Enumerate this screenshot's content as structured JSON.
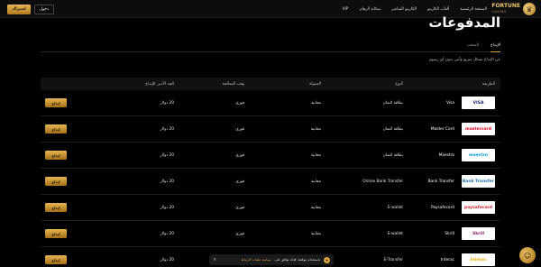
{
  "header": {
    "logo_name": "FORTUNE",
    "logo_sub": "CASINO",
    "nav": [
      "الصفحة الرئيسية",
      "ألعاب الكازينو",
      "الكازينو المباشر",
      "سكانة الرهان",
      "VIP"
    ],
    "login_label": "دخول",
    "register_label": "اشتراك"
  },
  "page": {
    "title": "المدفوعات",
    "tabs": [
      "الإيداع",
      "السحب"
    ],
    "intro": "عن الإيداع بشكل سريع وآمن بدون أي رسوم"
  },
  "table": {
    "headers": {
      "method": "الطريقة",
      "type": "النوع",
      "fee": "العمولة",
      "time": "وقت المعالجة",
      "min": "الحد الأدنى للإيداع",
      "action": ""
    },
    "rows": [
      {
        "name": "Visa",
        "logo": "VISA",
        "logo_color": "#1a1f71",
        "type": "بطاقة ائتمان",
        "fee": "مجانية",
        "time": "فوري",
        "min": "20 دولار",
        "action": "إيداع"
      },
      {
        "name": "Master Card",
        "logo": "mastercard",
        "logo_color": "#eb001b",
        "type": "بطاقة ائتمان",
        "fee": "مجانية",
        "time": "فوري",
        "min": "20 دولار",
        "action": "إيداع"
      },
      {
        "name": "Maestro",
        "logo": "maestro",
        "logo_color": "#0099df",
        "type": "بطاقة ائتمان",
        "fee": "مجانية",
        "time": "فوري",
        "min": "20 دولار",
        "action": "إيداع"
      },
      {
        "name": "Bank Transfer",
        "logo": "Bank Transfer",
        "logo_color": "#1d6fb8",
        "type": "Online Bank Transfer",
        "fee": "مجانية",
        "time": "فوري",
        "min": "20 دولار",
        "action": "إيداع"
      },
      {
        "name": "Paysafecard",
        "logo": "paysafecard",
        "logo_color": "#d2232a",
        "type": "E-wallet",
        "fee": "مجانية",
        "time": "فوري",
        "min": "20 دولار",
        "action": "إيداع"
      },
      {
        "name": "Skrill",
        "logo": "Skrill",
        "logo_color": "#862165",
        "type": "E-wallet",
        "fee": "مجانية",
        "time": "فوري",
        "min": "20 دولار",
        "action": "إيداع"
      },
      {
        "name": "Interac",
        "logo": "Interac",
        "logo_color": "#f5a800",
        "type": "E-Transfer",
        "fee": "مجانية",
        "time": "فوري",
        "min": "20 دولار",
        "action": "إيداع"
      }
    ]
  },
  "cookie": {
    "text": "باستخدام موقعنا، فإنك توافق على",
    "link": "سياسة ملفات الارتباط"
  },
  "colors": {
    "accent": "#d9a441",
    "background": "#000000"
  }
}
